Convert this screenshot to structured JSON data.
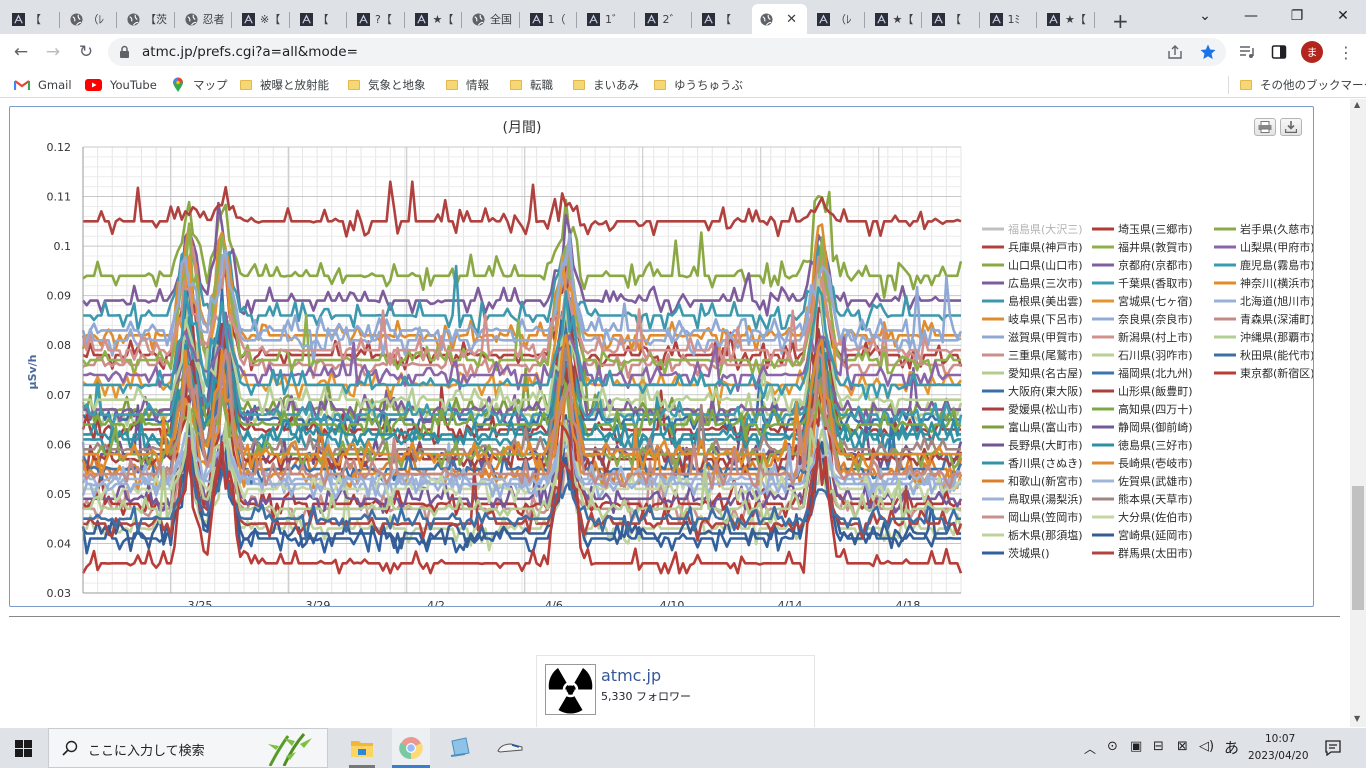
{
  "browser": {
    "tabs": [
      {
        "title": "【",
        "icon": "site-icon"
      },
      {
        "title": "（ﾚ",
        "icon": "globe-icon"
      },
      {
        "title": "【茨",
        "icon": "globe-icon"
      },
      {
        "title": "忍者",
        "icon": "globe-icon"
      },
      {
        "title": "※【",
        "icon": "site-icon"
      },
      {
        "title": "【",
        "icon": "site-icon"
      },
      {
        "title": "?【",
        "icon": "site-icon"
      },
      {
        "title": "★【",
        "icon": "site-icon"
      },
      {
        "title": "全国",
        "icon": "globe-icon"
      },
      {
        "title": "1（",
        "icon": "site-icon"
      },
      {
        "title": "1゛",
        "icon": "site-icon"
      },
      {
        "title": "2゛",
        "icon": "site-icon"
      },
      {
        "title": "【",
        "icon": "site-icon"
      },
      {
        "title": "",
        "icon": "globe-icon"
      },
      {
        "title": "（ﾚ",
        "icon": "site-icon"
      },
      {
        "title": "★【",
        "icon": "site-icon"
      },
      {
        "title": "【",
        "icon": "site-icon"
      },
      {
        "title": "1ﾐ",
        "icon": "site-icon"
      },
      {
        "title": "★【",
        "icon": "site-icon"
      }
    ],
    "active_tab": 13,
    "new_tab": "+",
    "url": "atmc.jp/prefs.cgi?a=all&mode=",
    "profile_initial": "ま",
    "bookmarks": [
      {
        "label": "Gmail",
        "icon": "gmail-icon"
      },
      {
        "label": "YouTube",
        "icon": "youtube-icon"
      },
      {
        "label": "マップ",
        "icon": "maps-icon"
      },
      {
        "label": "被曝と放射能",
        "icon": "folder-icon"
      },
      {
        "label": "気象と地象",
        "icon": "folder-icon"
      },
      {
        "label": "情報",
        "icon": "folder-icon"
      },
      {
        "label": "転職",
        "icon": "folder-icon"
      },
      {
        "label": "まいあみ",
        "icon": "folder-icon"
      },
      {
        "label": "ゆうちゅうぶ",
        "icon": "folder-icon"
      }
    ],
    "other_bookmarks": "その他のブックマーク"
  },
  "chart_data": {
    "type": "line",
    "title": "(月間)",
    "ylabel": "μSv/h",
    "xlabel": "",
    "ylim": [
      0.03,
      0.12
    ],
    "yticks": [
      "0.12",
      "0.11",
      "0.1",
      "0.09",
      "0.08",
      "0.07",
      "0.06",
      "0.05",
      "0.04",
      "0.03"
    ],
    "xticks": [
      "3/25",
      "3/29",
      "4/2",
      "4/6",
      "4/10",
      "4/14",
      "4/18"
    ],
    "grid": true,
    "legend_position": "right",
    "series": [
      {
        "name": "福島県(大沢三)",
        "color": "#c0c0c0",
        "level": 0.0,
        "hidden": true
      },
      {
        "name": "兵庫県(神戸市)",
        "color": "#b0413e",
        "level": 0.078
      },
      {
        "name": "山口県(山口市)",
        "color": "#8aa843",
        "level": 0.094
      },
      {
        "name": "広島県(三次市)",
        "color": "#7e5c9c",
        "level": 0.089
      },
      {
        "name": "島根県(美出雲)",
        "color": "#3d98ad",
        "level": 0.086
      },
      {
        "name": "岐阜県(下呂市)",
        "color": "#e08b2c",
        "level": 0.082
      },
      {
        "name": "滋賀県(甲賀市)",
        "color": "#8fa8d4",
        "level": 0.083
      },
      {
        "name": "三重県(尾鷲市)",
        "color": "#cd8e8a",
        "level": 0.076
      },
      {
        "name": "愛知県(名古屋)",
        "color": "#b5cc8e",
        "level": 0.066
      },
      {
        "name": "大阪府(東大阪)",
        "color": "#3a6ea8",
        "level": 0.065
      },
      {
        "name": "愛媛県(松山市)",
        "color": "#ab3f3d",
        "level": 0.063
      },
      {
        "name": "富山県(富山市)",
        "color": "#7e9e3f",
        "level": 0.067
      },
      {
        "name": "長野県(大町市)",
        "color": "#6f5592",
        "level": 0.058
      },
      {
        "name": "香川県(さぬき)",
        "color": "#3393a7",
        "level": 0.061
      },
      {
        "name": "和歌山(新宮市)",
        "color": "#da7f2c",
        "level": 0.055
      },
      {
        "name": "鳥取県(湯梨浜)",
        "color": "#9cb3d8",
        "level": 0.052
      },
      {
        "name": "岡山県(笠岡市)",
        "color": "#c8928f",
        "level": 0.047
      },
      {
        "name": "栃木県(那須塩)",
        "color": "#bed39b",
        "level": 0.043
      },
      {
        "name": "茨城県()",
        "color": "#31609e",
        "level": 0.041
      },
      {
        "name": "埼玉県(三郷市)",
        "color": "#b23b36",
        "level": 0.048
      },
      {
        "name": "福井県(敦賀市)",
        "color": "#8fb04b",
        "level": 0.077
      },
      {
        "name": "京都府(京都市)",
        "color": "#805f9e",
        "level": 0.067
      },
      {
        "name": "千葉県(香取市)",
        "color": "#3c9cb0",
        "level": 0.066
      },
      {
        "name": "宮城県(七ヶ宿)",
        "color": "#e5952f",
        "level": 0.072
      },
      {
        "name": "奈良県(奈良市)",
        "color": "#92acd7",
        "level": 0.081
      },
      {
        "name": "新潟県(村上市)",
        "color": "#d2918d",
        "level": 0.079
      },
      {
        "name": "石川県(羽咋市)",
        "color": "#b8cf95",
        "level": 0.069
      },
      {
        "name": "福岡県(北九州)",
        "color": "#3e74ac",
        "level": 0.055
      },
      {
        "name": "山形県(飯豊町)",
        "color": "#a8403e",
        "level": 0.057
      },
      {
        "name": "高知県(四万十)",
        "color": "#7ea843",
        "level": 0.064
      },
      {
        "name": "静岡県(御前崎)",
        "color": "#74599a",
        "level": 0.049
      },
      {
        "name": "徳島県(三好市)",
        "color": "#2f8fa3",
        "level": 0.062
      },
      {
        "name": "長崎県(壱岐市)",
        "color": "#e08a33",
        "level": 0.054
      },
      {
        "name": "佐賀県(武雄市)",
        "color": "#9fb6d9",
        "level": 0.053
      },
      {
        "name": "熊本県(天草市)",
        "color": "#a28582",
        "level": 0.059
      },
      {
        "name": "大分県(佐伯市)",
        "color": "#c4d6a3",
        "level": 0.051
      },
      {
        "name": "宮崎県(延岡市)",
        "color": "#365d93",
        "level": 0.042
      },
      {
        "name": "群馬県(太田市)",
        "color": "#b24440",
        "level": 0.044
      },
      {
        "name": "岩手県(久慈市)",
        "color": "#89a94a",
        "level": 0.058
      },
      {
        "name": "山梨県(甲府市)",
        "color": "#8a65a8",
        "level": 0.074
      },
      {
        "name": "鹿児島(霧島市)",
        "color": "#3a9ab0",
        "level": 0.072
      },
      {
        "name": "神奈川(横浜市)",
        "color": "#e28b28",
        "level": 0.058
      },
      {
        "name": "北海道(旭川市)",
        "color": "#99b1d8",
        "level": 0.052
      },
      {
        "name": "青森県(深浦町)",
        "color": "#c48a86",
        "level": 0.054
      },
      {
        "name": "沖縄県(那覇市)",
        "color": "#b3cd92",
        "level": 0.047
      },
      {
        "name": "秋田県(能代市)",
        "color": "#3c6fa6",
        "level": 0.045
      },
      {
        "name": "東京都(新宿区)",
        "color": "#b83d39",
        "level": 0.036
      }
    ],
    "note_top_series": {
      "color": "#b0413e",
      "level": 0.105
    }
  },
  "chart_buttons": {
    "print": "print-icon",
    "download": "download-icon"
  },
  "follow_card": {
    "name": "atmc.jp",
    "followers": "5,330 フォロワー"
  },
  "taskbar": {
    "search_placeholder": "ここに入力して検索",
    "time": "10:07",
    "date": "2023/04/20",
    "ime": "あ"
  }
}
